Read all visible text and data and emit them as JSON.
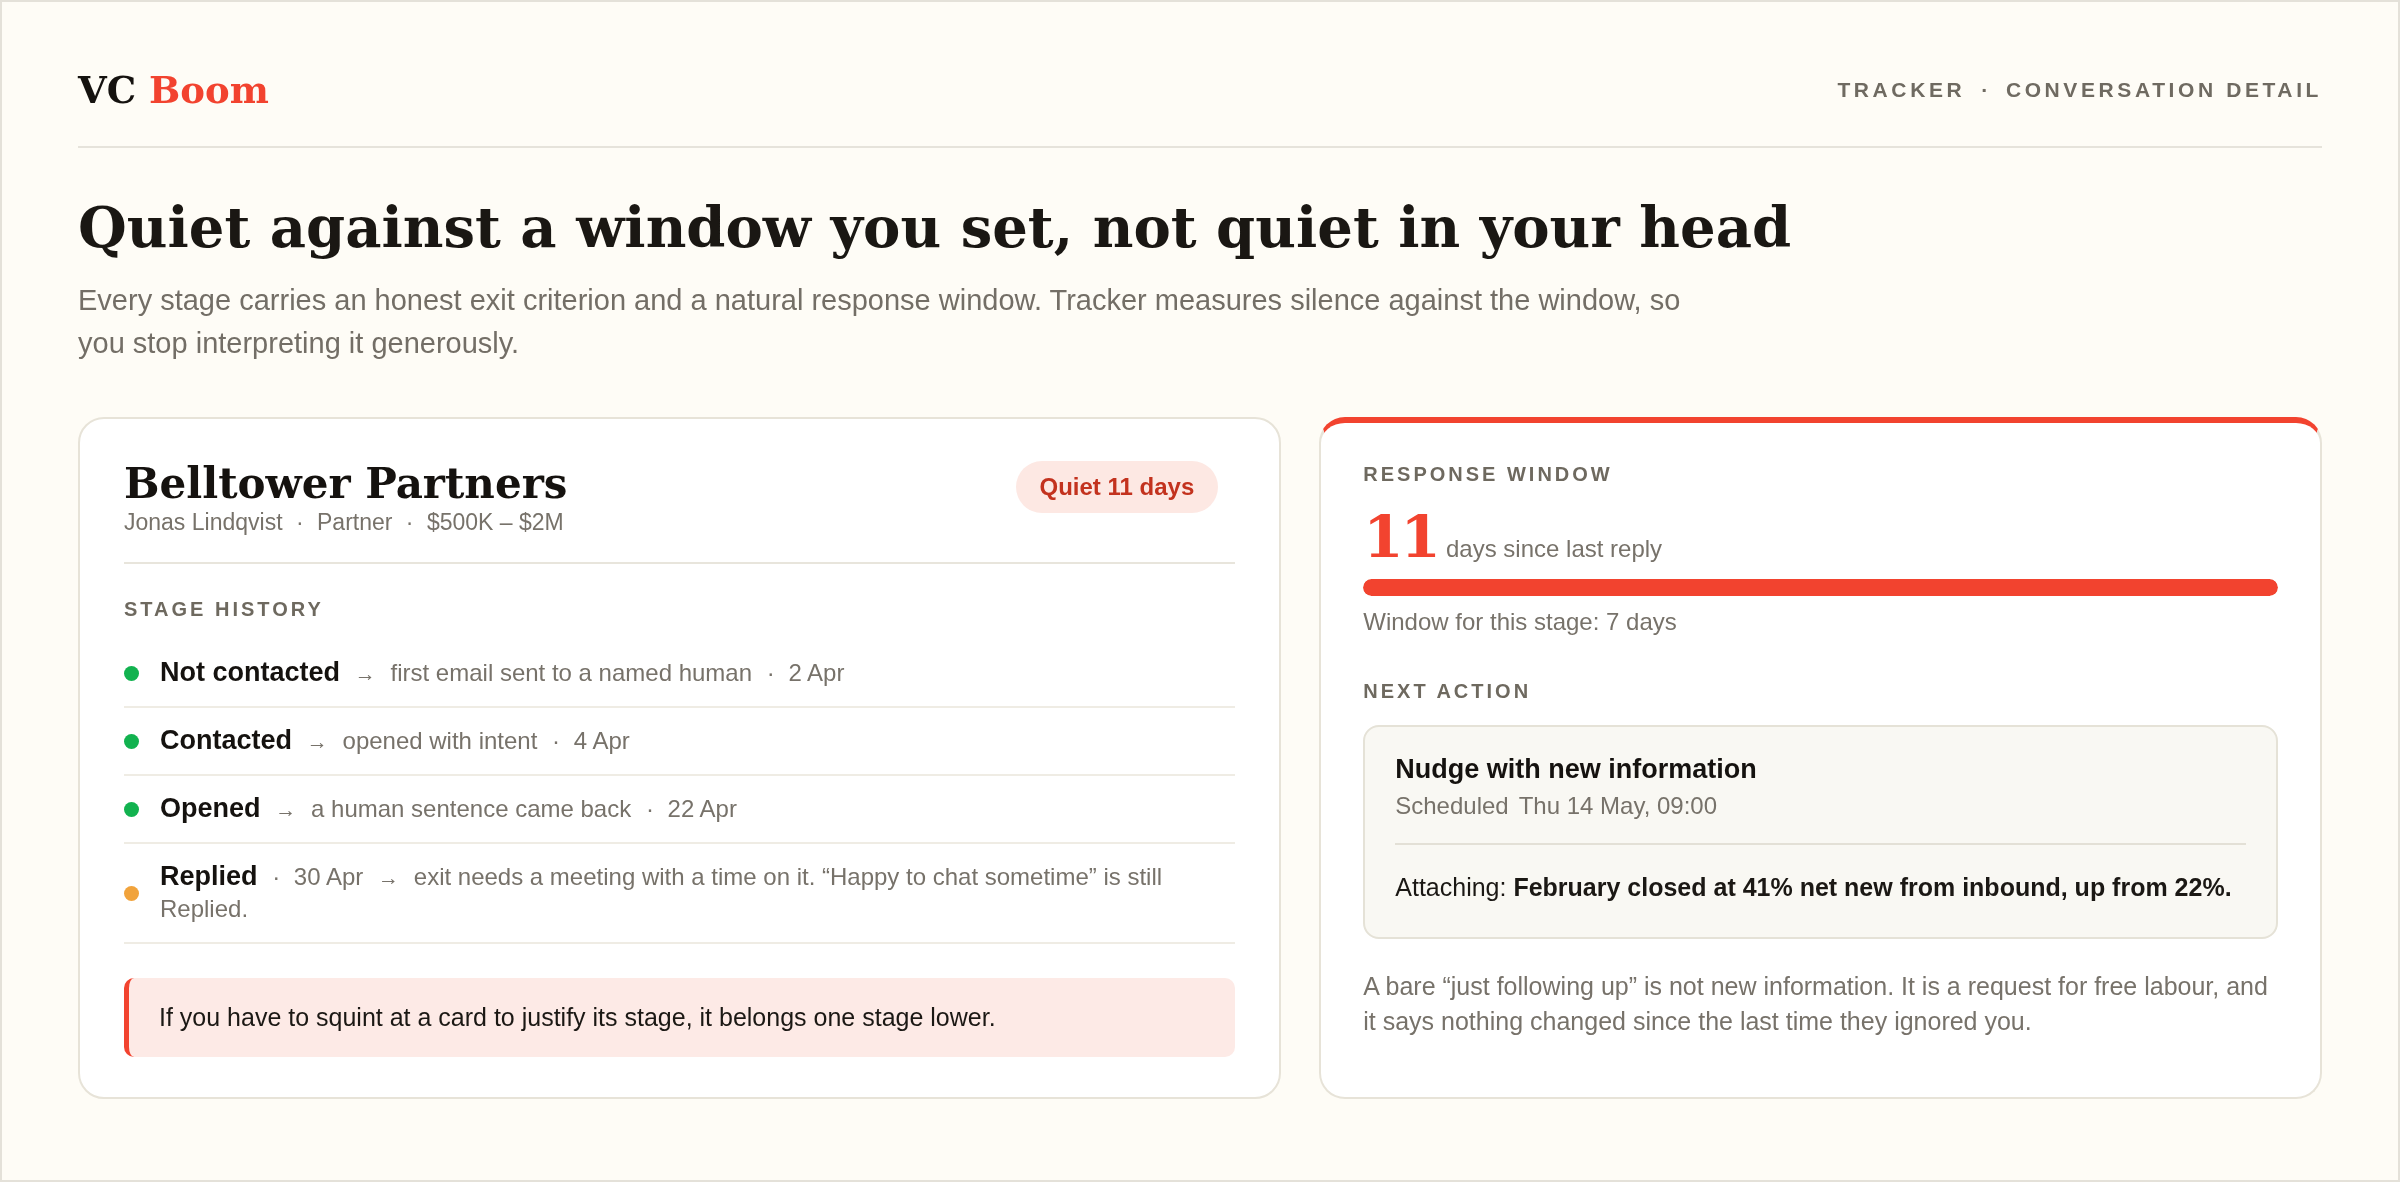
{
  "logo": {
    "text": "VC",
    "accent": "Boom"
  },
  "breadcrumbs": [
    {
      "label": "TRACKER"
    },
    {
      "label": "CONVERSATION DETAIL"
    }
  ],
  "breadcrumb_separator": "·",
  "heading": "Quiet against a window you set, not quiet in your head",
  "intro": "Every stage carries an honest exit criterion and a natural response window. Tracker measures silence against the window, so you stop interpreting it generously.",
  "conversation": {
    "firm": "Belltower Partners",
    "meta": [
      {
        "text": "Jonas Lindqvist"
      },
      {
        "sep": "·",
        "text": "Partner"
      },
      {
        "sep": "·",
        "text": "$500K – $2M"
      }
    ],
    "status": "Quiet 11 days",
    "section_label": "STAGE HISTORY",
    "stages": [
      {
        "kind": "done",
        "color": "#12b24f",
        "name": "Not contacted",
        "arrow": "→",
        "criterion": "first email sent to a named human",
        "sep": "·",
        "date": "2 Apr"
      },
      {
        "kind": "done",
        "color": "#12b24f",
        "name": "Contacted",
        "arrow": "→",
        "criterion": "opened with intent",
        "sep": "·",
        "date": "4 Apr"
      },
      {
        "kind": "done",
        "color": "#12b24f",
        "name": "Opened",
        "arrow": "→",
        "criterion": "a human sentence came back",
        "sep": "·",
        "date": "22 Apr"
      },
      {
        "kind": "current",
        "color": "#f1a33c",
        "name": "Replied",
        "sep": "·",
        "date": "30 Apr",
        "arrow": "→",
        "criterion": "exit needs a meeting with a time on it. “Happy to chat sometime” is still Replied."
      }
    ],
    "callout": "If you have to squint at a card to justify its stage, it belongs one stage lower."
  },
  "response_window": {
    "label": "RESPONSE WINDOW",
    "days": "11",
    "days_label": "days since last reply",
    "progress": {
      "level": 1
    },
    "window_note": "Window for this stage: 7 days"
  },
  "next_action": {
    "label": "NEXT ACTION",
    "title": "Nudge with new information",
    "scheduled_label": "Scheduled",
    "scheduled_time": "Thu 14 May, 09:00",
    "attachment": "Attaching: **February closed at 41% net new from inbound, up from 22%.**",
    "note": "A bare “just following up” is not new information. It is a request for free labour, and it says nothing changed since the last time they ignored you."
  }
}
